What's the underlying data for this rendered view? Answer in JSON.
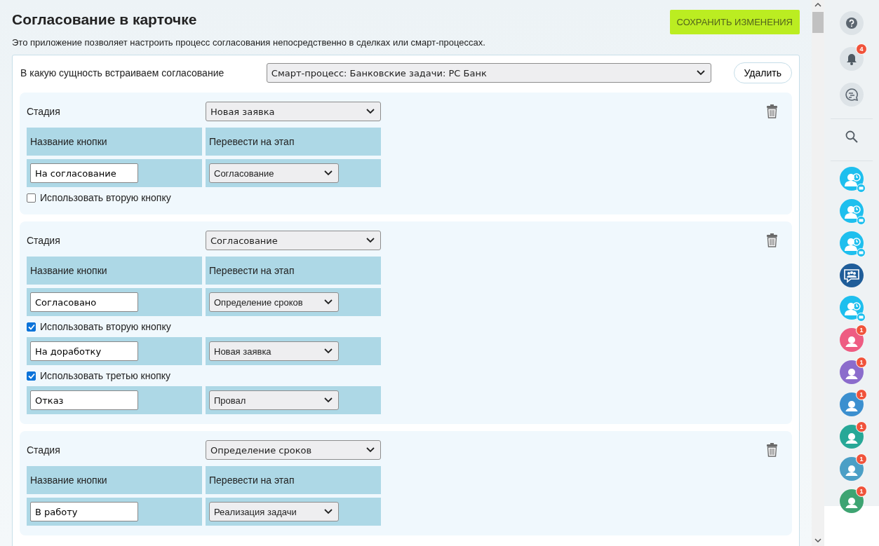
{
  "header": {
    "title": "Согласование в карточке",
    "description": "Это приложение позволяет настроить процесс согласования непосредственно в сделках или смарт-процессах.",
    "save_button": "СОХРАНИТЬ ИЗМЕНЕНИЯ"
  },
  "entity": {
    "label": "В какую сущность встраиваем согласование",
    "value": "Смарт-процесс: Банковские задачи: РС Банк",
    "delete_button": "Удалить"
  },
  "stages": [
    {
      "label": "Стадия",
      "value": "Новая заявка",
      "columns": [
        "Название кнопки",
        "Перевести на этап"
      ],
      "rows": [
        {
          "kind": "button",
          "name": "На согласование",
          "target": "Согласование"
        },
        {
          "kind": "checkbox",
          "label": "Использовать вторую кнопку",
          "checked": false
        }
      ]
    },
    {
      "label": "Стадия",
      "value": "Согласование",
      "columns": [
        "Название кнопки",
        "Перевести на этап"
      ],
      "rows": [
        {
          "kind": "button",
          "name": "Согласовано",
          "target": "Определение сроков"
        },
        {
          "kind": "checkbox",
          "label": "Использовать вторую кнопку",
          "checked": true
        },
        {
          "kind": "button",
          "name": "На доработку",
          "target": "Новая заявка"
        },
        {
          "kind": "checkbox",
          "label": "Использовать третью кнопку",
          "checked": true
        },
        {
          "kind": "button",
          "name": "Отказ",
          "target": "Провал"
        }
      ]
    },
    {
      "label": "Стадия",
      "value": "Определение сроков",
      "columns": [
        "Название кнопки",
        "Перевести на этап"
      ],
      "rows": [
        {
          "kind": "button",
          "name": "В работу",
          "target": "Реализация задачи"
        }
      ]
    }
  ],
  "sidebar": {
    "tools": [
      {
        "kind": "help"
      },
      {
        "kind": "bell",
        "badge": "4"
      },
      {
        "kind": "chat"
      },
      {
        "kind": "search"
      }
    ],
    "contacts": [
      {
        "kind": "contact",
        "color": "#1ebfee"
      },
      {
        "kind": "contact",
        "color": "#1ebfee"
      },
      {
        "kind": "contact",
        "color": "#1ebfee"
      },
      {
        "kind": "group",
        "color": "#1f5d99"
      },
      {
        "kind": "contact",
        "color": "#1ebfee"
      },
      {
        "kind": "user",
        "color": "#ee5c82",
        "badge": "1"
      },
      {
        "kind": "user",
        "color": "#8b6ccc",
        "badge": "1"
      },
      {
        "kind": "user",
        "color": "#3b8fcf",
        "badge": "1"
      },
      {
        "kind": "user",
        "color": "#27a897",
        "badge": "1"
      },
      {
        "kind": "user",
        "color": "#4b9fc6",
        "badge": "1"
      },
      {
        "kind": "user",
        "color": "#3ea472",
        "badge": "1"
      }
    ]
  }
}
